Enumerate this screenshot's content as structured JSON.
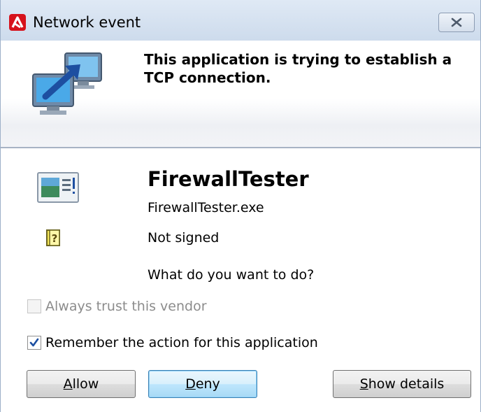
{
  "window": {
    "title": "Network event"
  },
  "header": {
    "message": "This application is trying to establish a TCP connection."
  },
  "app": {
    "name": "FirewallTester",
    "executable": "FirewallTester.exe",
    "signature_status": "Not signed",
    "prompt": "What do you want to do?"
  },
  "options": {
    "always_trust": {
      "label": "Always trust this vendor",
      "checked": false,
      "enabled": false
    },
    "remember": {
      "label": "Remember the action for this application",
      "checked": true,
      "enabled": true
    }
  },
  "buttons": {
    "allow": {
      "accel": "A",
      "rest": "llow"
    },
    "deny": {
      "accel": "D",
      "rest": "eny"
    },
    "details": {
      "accel": "S",
      "rest": "how details"
    }
  },
  "colors": {
    "brand_red": "#d6121b",
    "titlebar": "#dfe9f5",
    "default_button": "#bee6fd"
  }
}
